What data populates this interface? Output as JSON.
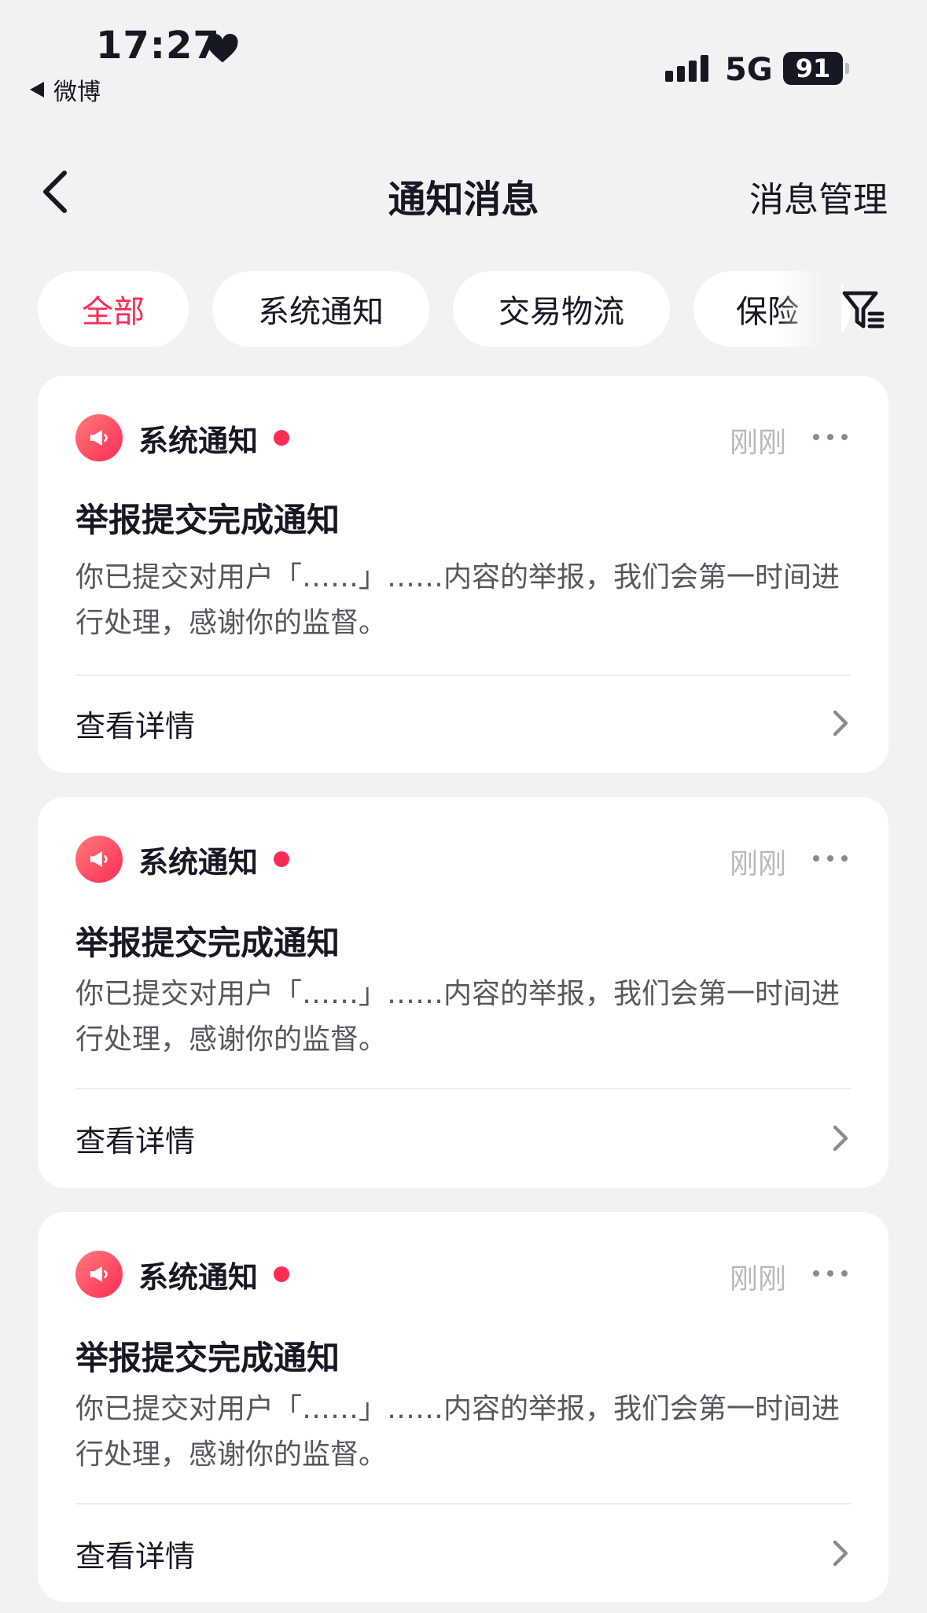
{
  "status_bar": {
    "time": "17:27",
    "back_app": "微博",
    "network": "5G",
    "battery": "91"
  },
  "nav": {
    "title": "通知消息",
    "action": "消息管理"
  },
  "tabs": [
    {
      "label": "全部",
      "active": true
    },
    {
      "label": "系统通知",
      "active": false
    },
    {
      "label": "交易物流",
      "active": false
    },
    {
      "label": "保险",
      "active": false
    }
  ],
  "notifications": [
    {
      "source": "系统通知",
      "time": "刚刚",
      "title": "举报提交完成通知",
      "body": "你已提交对用户「……」……内容的举报，我们会第一时间进行处理，感谢你的监督。",
      "detail": "查看详情"
    },
    {
      "source": "系统通知",
      "time": "刚刚",
      "title": "举报提交完成通知",
      "body": "你已提交对用户「……」……内容的举报，我们会第一时间进行处理，感谢你的监督。",
      "detail": "查看详情"
    },
    {
      "source": "系统通知",
      "time": "刚刚",
      "title": "举报提交完成通知",
      "body": "你已提交对用户「……」……内容的举报，我们会第一时间进行处理，感谢你的监督。",
      "detail": "查看详情"
    }
  ],
  "colors": {
    "accent": "#fe2c55",
    "background": "#f2f2f4",
    "muted": "#b9b9bd"
  }
}
